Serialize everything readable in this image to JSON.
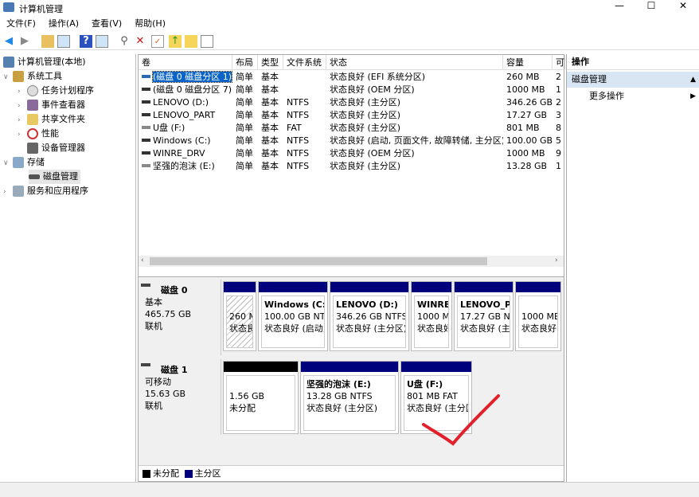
{
  "window": {
    "title": "计算机管理",
    "minimize": "—",
    "maximize": "☐",
    "close": "✕"
  },
  "menu": [
    "文件(F)",
    "操作(A)",
    "查看(V)",
    "帮助(H)"
  ],
  "tree": {
    "root": "计算机管理(本地)",
    "system_tools": "系统工具",
    "task_scheduler": "任务计划程序",
    "event_viewer": "事件查看器",
    "shared_folders": "共享文件夹",
    "performance": "性能",
    "device_manager": "设备管理器",
    "storage": "存储",
    "disk_management": "磁盘管理",
    "services": "服务和应用程序"
  },
  "table": {
    "columns": [
      "卷",
      "布局",
      "类型",
      "文件系统",
      "状态",
      "容量",
      "可"
    ],
    "rows": [
      [
        "(磁盘 0 磁盘分区 1)",
        "简单",
        "基本",
        "",
        "状态良好 (EFI 系统分区)",
        "260 MB",
        "2"
      ],
      [
        "(磁盘 0 磁盘分区 7)",
        "简单",
        "基本",
        "",
        "状态良好 (OEM 分区)",
        "1000 MB",
        "1"
      ],
      [
        "LENOVO (D:)",
        "简单",
        "基本",
        "NTFS",
        "状态良好 (主分区)",
        "346.26 GB",
        "2"
      ],
      [
        "LENOVO_PART",
        "简单",
        "基本",
        "NTFS",
        "状态良好 (主分区)",
        "17.27 GB",
        "3"
      ],
      [
        "U盘 (F:)",
        "简单",
        "基本",
        "FAT",
        "状态良好 (主分区)",
        "801 MB",
        "8"
      ],
      [
        "Windows (C:)",
        "简单",
        "基本",
        "NTFS",
        "状态良好 (启动, 页面文件, 故障转储, 主分区)",
        "100.00 GB",
        "5"
      ],
      [
        "WINRE_DRV",
        "简单",
        "基本",
        "NTFS",
        "状态良好 (OEM 分区)",
        "1000 MB",
        "9"
      ],
      [
        "坚强的泡沫 (E:)",
        "简单",
        "基本",
        "NTFS",
        "状态良好 (主分区)",
        "13.28 GB",
        "1"
      ]
    ]
  },
  "disks": [
    {
      "name": "磁盘 0",
      "type": "基本",
      "size": "465.75 GB",
      "state": "联机",
      "parts": [
        {
          "title": "",
          "size": "260 M",
          "status": "状态良",
          "hatch": true
        },
        {
          "title": "Windows  (C:)",
          "size": "100.00 GB NTF",
          "status": "状态良好 (启动,"
        },
        {
          "title": "LENOVO  (D:)",
          "size": "346.26 GB NTFS",
          "status": "状态良好 (主分区)"
        },
        {
          "title": "WINRE_",
          "size": "1000 M",
          "status": "状态良好"
        },
        {
          "title": "LENOVO_PA",
          "size": "17.27 GB NT",
          "status": "状态良好 (主:"
        },
        {
          "title": "",
          "size": "1000 ME",
          "status": "状态良好"
        }
      ]
    },
    {
      "name": "磁盘 1",
      "type": "可移动",
      "size": "15.63 GB",
      "state": "联机",
      "parts": [
        {
          "title": "",
          "size": "1.56 GB",
          "status": "未分配",
          "unalloc": true
        },
        {
          "title": "坚强的泡沫  (E:)",
          "size": "13.28 GB NTFS",
          "status": "状态良好 (主分区)"
        },
        {
          "title": "U盘  (F:)",
          "size": "801 MB FAT",
          "status": "状态良好 (主分区"
        }
      ]
    }
  ],
  "legend": {
    "unallocated": "未分配",
    "primary": "主分区",
    "colors": {
      "unallocated": "#000000",
      "primary": "#00007c"
    }
  },
  "actions": {
    "header": "操作",
    "section": "磁盘管理",
    "more": "更多操作"
  }
}
